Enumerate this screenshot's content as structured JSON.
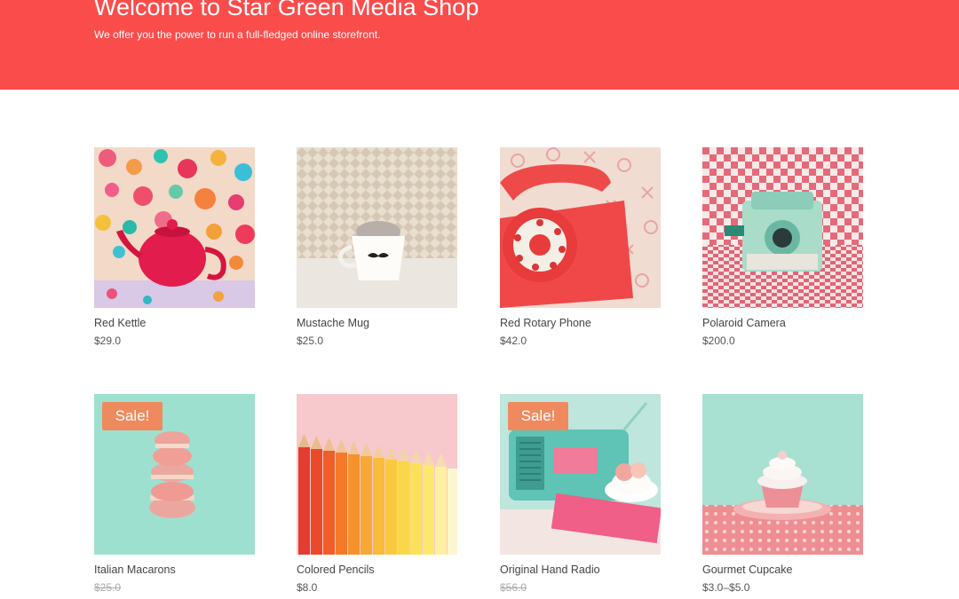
{
  "hero": {
    "title": "Welcome to Star Green Media Shop",
    "subtitle": "We offer you the power to run a full-fledged online storefront."
  },
  "colors": {
    "hero_bg": "#fb4c4c",
    "sale_badge": "#ef8a5f"
  },
  "products": [
    {
      "name": "Red Kettle",
      "price": "$29.0",
      "image": "red-kettle-photo"
    },
    {
      "name": "Mustache Mug",
      "price": "$25.0",
      "image": "mustache-mug-photo"
    },
    {
      "name": "Red Rotary Phone",
      "price": "$42.0",
      "image": "red-rotary-phone-photo"
    },
    {
      "name": "Polaroid Camera",
      "price": "$200.0",
      "image": "polaroid-camera-photo"
    },
    {
      "name": "Italian Macarons",
      "price": "$25.0",
      "sale": "Sale!",
      "image": "italian-macarons-photo"
    },
    {
      "name": "Colored Pencils",
      "price": "$8.0",
      "image": "colored-pencils-photo"
    },
    {
      "name": "Original Hand Radio",
      "price": "$56.0",
      "sale": "Sale!",
      "image": "hand-radio-photo"
    },
    {
      "name": "Gourmet Cupcake",
      "price": "$3.0–$5.0",
      "image": "gourmet-cupcake-photo"
    }
  ]
}
